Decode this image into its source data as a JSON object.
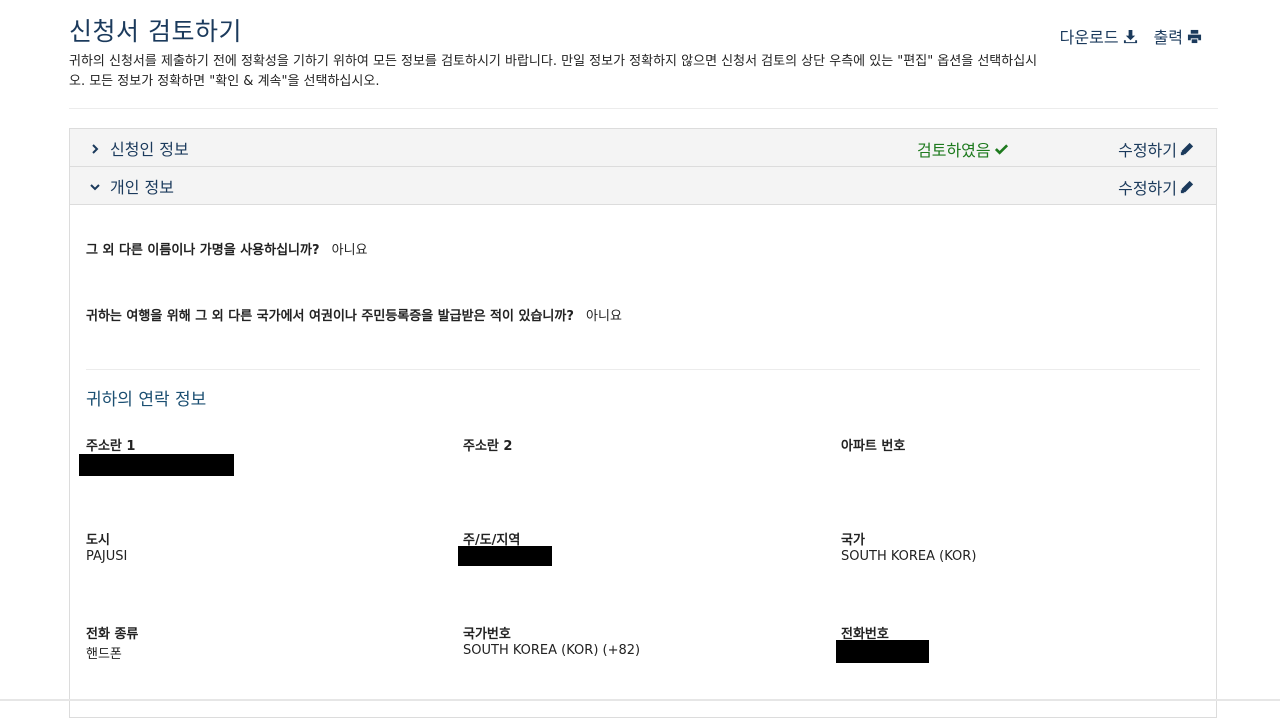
{
  "page": {
    "title": "신청서 검토하기",
    "intro": "귀하의 신청서를 제출하기 전에 정확성을 기하기 위하여 모든 정보를 검토하시기 바랍니다. 만일 정보가 정확하지 않으면 신청서 검토의 상단 우측에 있는 \"편집\" 옵션을 선택하십시오. 모든 정보가 정확하면 \"확인 & 계속\"을 선택하십시오."
  },
  "actions": {
    "download_label": "다운로드",
    "print_label": "출력"
  },
  "sections": {
    "applicant": {
      "title": "신청인 정보",
      "status": "검토하였음",
      "edit_label": "수정하기",
      "expanded": false
    },
    "personal": {
      "title": "개인 정보",
      "edit_label": "수정하기",
      "expanded": true
    }
  },
  "questions": [
    {
      "q": "그 외 다른 이름이나 가명을 사용하십니까?",
      "a": "아니요"
    },
    {
      "q": "귀하는 여행을 위해 그 외 다른 국가에서 여권이나 주민등록증을 발급받은 적이 있습니까?",
      "a": "아니요"
    }
  ],
  "contact": {
    "heading": "귀하의 연락 정보",
    "address1": {
      "label": "주소란 1",
      "value": ""
    },
    "address2": {
      "label": "주소란 2",
      "value": ""
    },
    "apt": {
      "label": "아파트 번호",
      "value": ""
    },
    "city": {
      "label": "도시",
      "value": "PAJUSI"
    },
    "state": {
      "label": "주/도/지역",
      "value": ""
    },
    "country": {
      "label": "국가",
      "value": "SOUTH KOREA (KOR)"
    },
    "phone_type": {
      "label": "전화 종류",
      "value": "핸드폰"
    },
    "country_code": {
      "label": "국가번호",
      "value": "SOUTH KOREA (KOR) (+82)"
    },
    "phone": {
      "label": "전화번호",
      "value": ""
    }
  },
  "colors": {
    "heading": "#1b3a5c",
    "reviewed": "#1e7a1e",
    "header_bg": "#f4f4f4"
  },
  "icons": {
    "download": "download-icon",
    "print": "print-icon",
    "check": "check-icon",
    "edit": "pencil-icon",
    "collapsed": "chevron-right-icon",
    "expanded": "chevron-down-icon"
  }
}
